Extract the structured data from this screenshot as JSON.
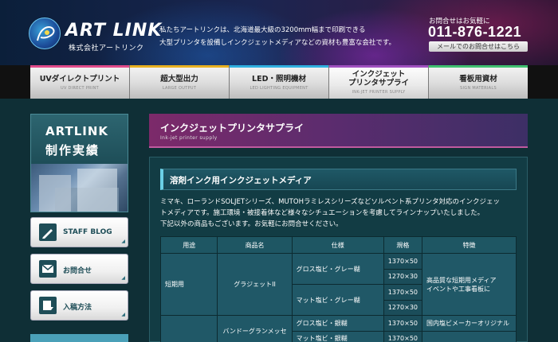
{
  "header": {
    "logo_text": "ART LINK",
    "logo_sub": "株式会社アートリンク",
    "tagline_line1": "私たちアートリンクは、北海道最大級の3200mm幅まで印刷できる",
    "tagline_line2": "大型プリンタを設備しインクジェットメディアなどの資材も豊富な会社です。",
    "contact_label": "お問合せはお気軽に",
    "phone": "011-876-1221",
    "mail_button": "メールでのお問合せはこちら"
  },
  "nav": {
    "items": [
      {
        "label": "UVダイレクトプリント",
        "sub": "UV DIRECT PRINT",
        "color": "#e04a8a"
      },
      {
        "label": "超大型出力",
        "sub": "LARGE OUTPUT",
        "color": "#e8b020"
      },
      {
        "label": "LED・照明機材",
        "sub": "LED LIGHTING EQUIPMENT",
        "color": "#30b0e0"
      },
      {
        "label1": "インクジェット",
        "label2": "プリンタサプライ",
        "sub": "INK-JET PRINTER SUPPLY",
        "color": "#a050c0"
      },
      {
        "label": "看板用資材",
        "sub": "SIGN MATERIALS",
        "color": "#40c070"
      }
    ]
  },
  "sidebar": {
    "artlink_title": "ARTLINK",
    "artlink_sub": "制作実績",
    "buttons": [
      {
        "label": "STAFF BLOG",
        "icon": "pencil-icon"
      },
      {
        "label": "お問合せ",
        "icon": "mail-icon"
      },
      {
        "label": "入稿方法",
        "icon": "upload-icon"
      }
    ]
  },
  "main": {
    "page_title": "インクジェットプリンタサプライ",
    "page_sub": "Ink-jet printer supply",
    "section_title": "溶剤インク用インクジェットメディア",
    "desc_line1": "ミマキ、ローランドSOLJETシリーズ、MUTOHラミレスシリーズなどソルベント系プリンタ対応のインクジェッ",
    "desc_line2": "トメディアです。施工環境・被接着体など様々なシチュエーションを考慮してラインナップいたしました。",
    "desc_line3": "下記以外の商品もございます。お気軽にお問合せください。",
    "table": {
      "headers": [
        "用途",
        "商品名",
        "仕様",
        "規格",
        "特徴"
      ],
      "rows": {
        "r1": {
          "usage": "短期用",
          "product": "グラジェットII",
          "spec1": "グロス塩ビ・グレー糊",
          "spec2": "マット塩ビ・グレー糊",
          "size1": "1370×50",
          "size2": "1270×30",
          "size3": "1370×50",
          "size4": "1270×30",
          "feature1": "高品質な短期用メディア",
          "feature2": "イベントや工事看板に"
        },
        "r2": {
          "product": "バンドーグランメッセ",
          "spec1": "グロス塩ビ・銀糊",
          "spec2": "マット塩ビ・銀糊",
          "size1": "1370×50",
          "size2": "1370×50",
          "feature1": "国内塩ビメーカーオリジナル"
        }
      }
    }
  }
}
